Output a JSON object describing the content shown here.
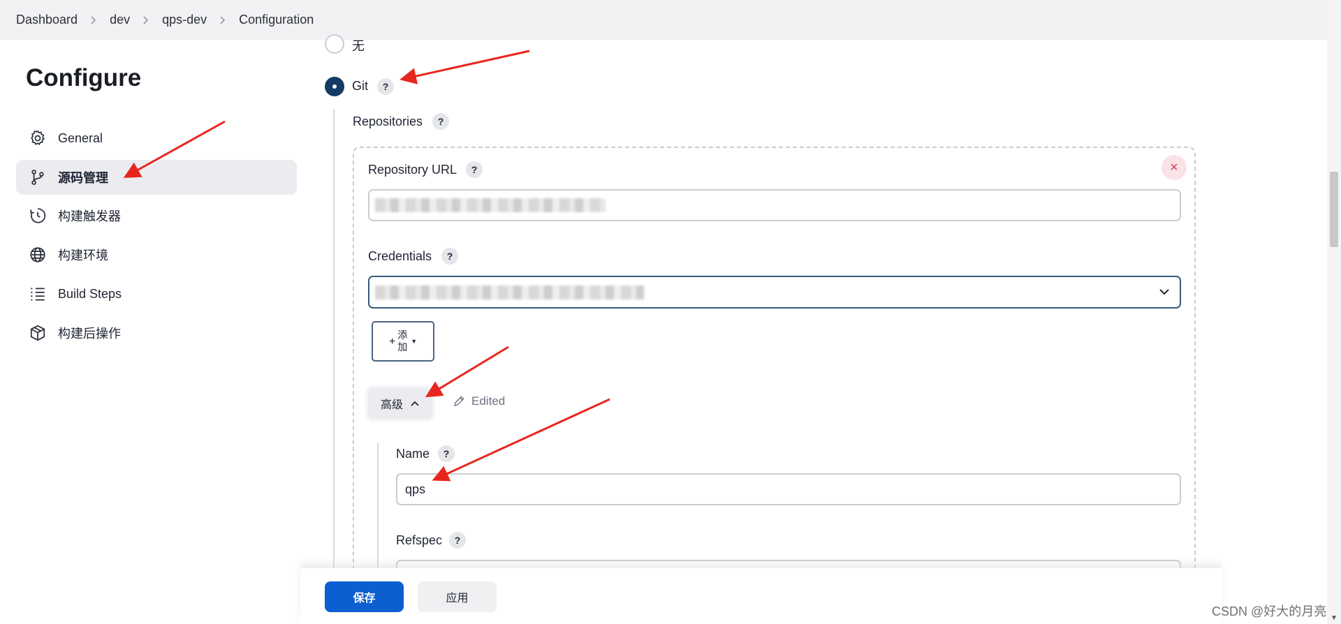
{
  "breadcrumb": [
    "Dashboard",
    "dev",
    "qps-dev",
    "Configuration"
  ],
  "sidebar": {
    "title": "Configure",
    "items": [
      {
        "label": "General",
        "icon": "gear-icon",
        "active": false
      },
      {
        "label": "源码管理",
        "icon": "branch-icon",
        "active": true
      },
      {
        "label": "构建触发器",
        "icon": "clock-icon",
        "active": false
      },
      {
        "label": "构建环境",
        "icon": "globe-icon",
        "active": false
      },
      {
        "label": "Build Steps",
        "icon": "list-icon",
        "active": false
      },
      {
        "label": "构建后操作",
        "icon": "package-icon",
        "active": false
      }
    ]
  },
  "scm": {
    "option_none": "无",
    "option_git": "Git",
    "selected": "Git",
    "help": "?",
    "repositories_label": "Repositories",
    "repository_url_label": "Repository URL",
    "credentials_label": "Credentials",
    "add_button_label": "添加",
    "add_button_plus": "+",
    "advanced_label": "高级",
    "edited_label": "Edited",
    "name_label": "Name",
    "name_value": "qps",
    "refspec_label": "Refspec",
    "remove_icon": "×"
  },
  "actions": {
    "save_label": "保存",
    "apply_label": "应用"
  },
  "watermark": "CSDN @好大的月亮",
  "colors": {
    "primary": "#0b5fd0",
    "radio_selected": "#133b63",
    "annotation_arrow": "#e8261e",
    "remove": "#d63a4d"
  }
}
